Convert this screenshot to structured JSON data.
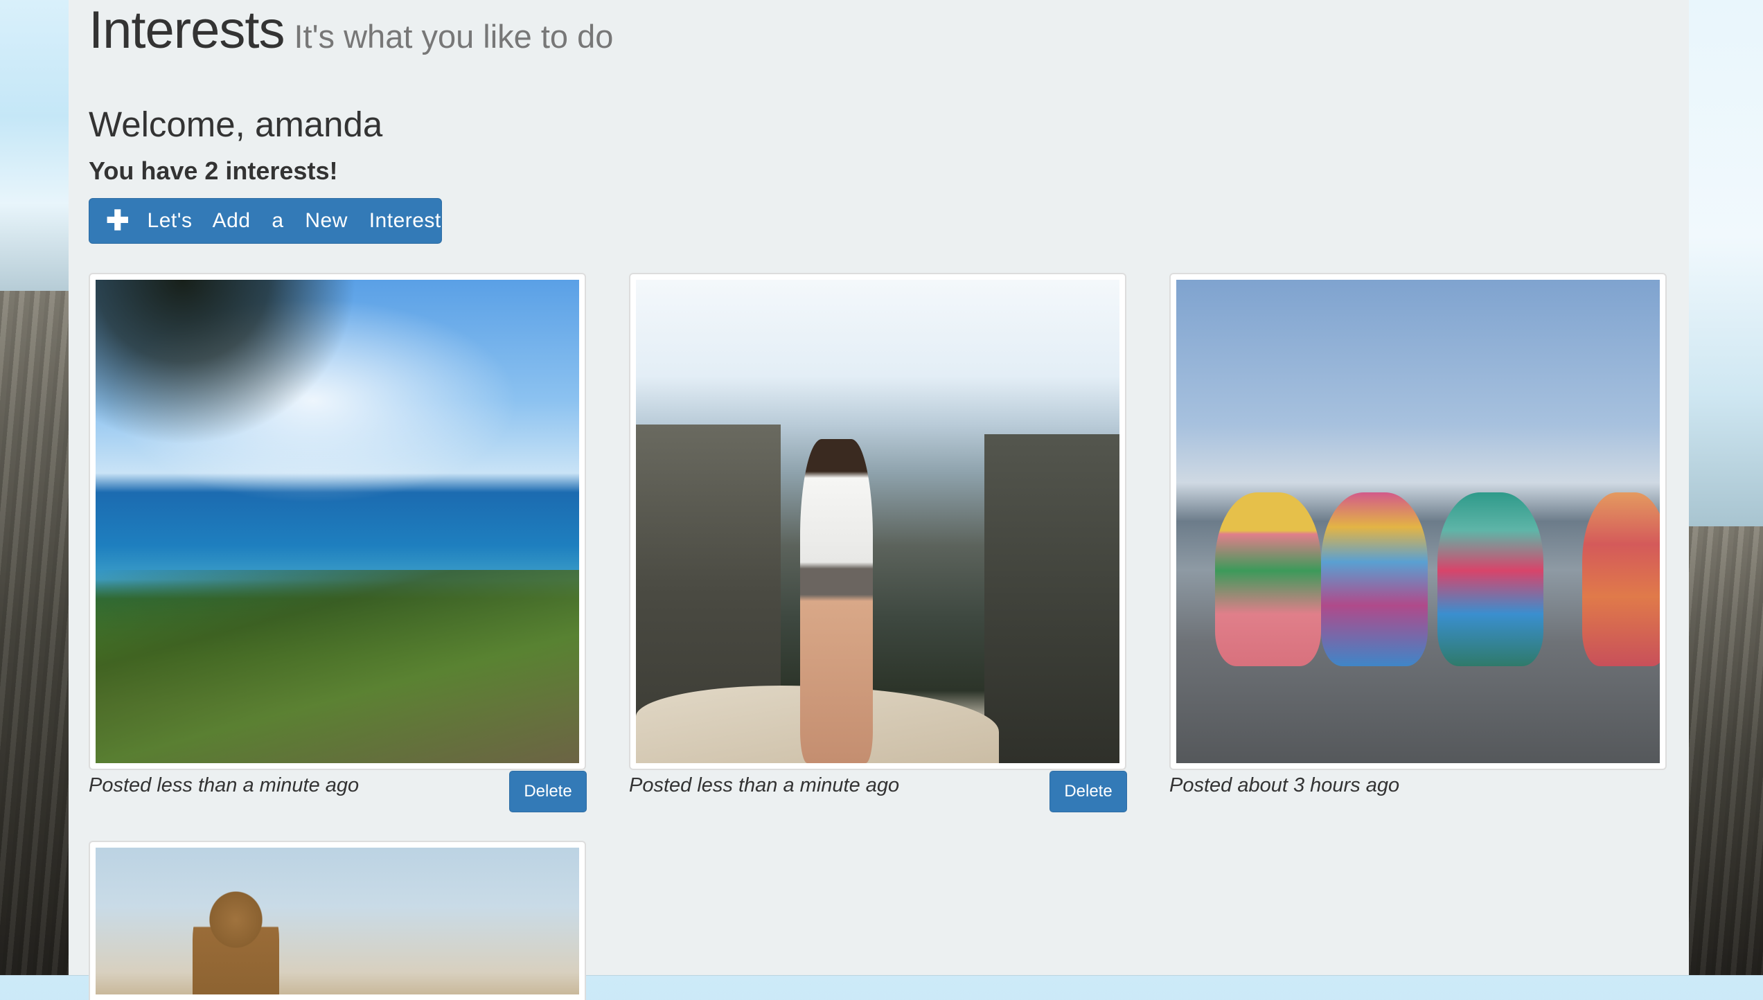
{
  "header": {
    "title": "Interests",
    "subtitle": "It's what you like to do"
  },
  "welcome": "Welcome, amanda",
  "interest_count_text": "You have 2 interests!",
  "add_button": {
    "icon": "plus-icon",
    "label": "Let's Add a New Interest"
  },
  "interests": [
    {
      "photo": "coastline with turquoise sea and rocks",
      "caption": "Posted less than a minute ago",
      "delete_label": "Delete"
    },
    {
      "photo": "woman looking over rock pillars and valley",
      "caption": "Posted less than a minute ago",
      "delete_label": "Delete"
    },
    {
      "photo": "row of colorful painted buddha figurines",
      "caption": "Posted about 3 hours ago"
    },
    {
      "photo": "hooded figure in desert landscape"
    }
  ],
  "colors": {
    "primary_button": "#337ab7",
    "page_background": "#ecf0f1",
    "text": "#333333",
    "subtitle_text": "#777777"
  }
}
